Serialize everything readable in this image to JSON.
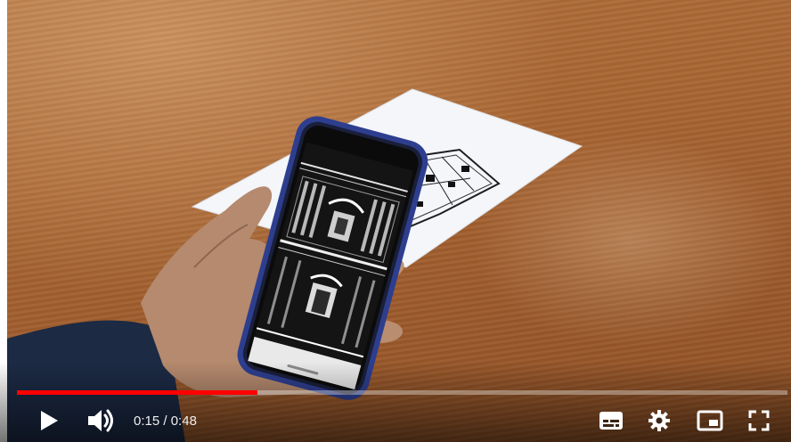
{
  "player": {
    "progress_fraction": 0.3125,
    "time": {
      "current": "0:15",
      "separator": " / ",
      "duration": "0:48"
    },
    "icons": {
      "play": "play-icon",
      "volume": "volume-icon",
      "subtitles": "subtitles-icon",
      "settings": "settings-icon",
      "miniplayer": "miniplayer-icon",
      "fullscreen": "fullscreen-icon"
    },
    "colors": {
      "progress_played": "#ff0000",
      "controls": "#ffffff"
    }
  }
}
